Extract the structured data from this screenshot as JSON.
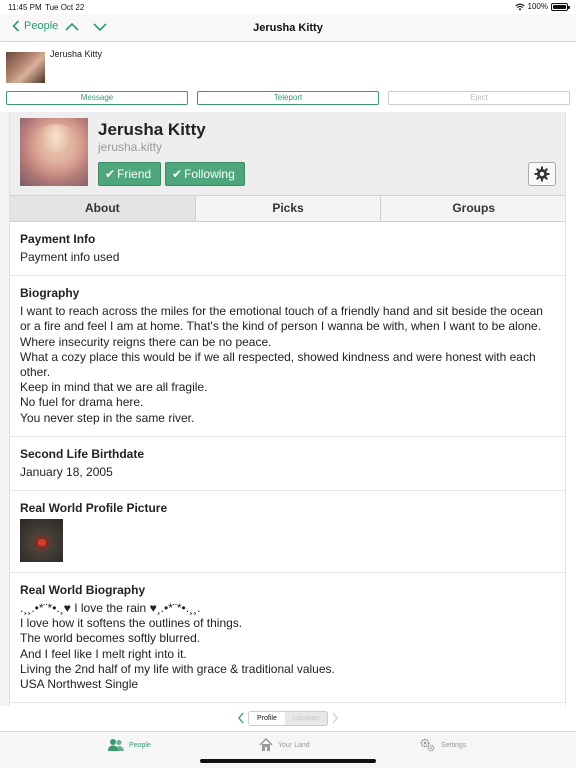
{
  "status_bar": {
    "time": "11:45 PM",
    "date": "Tue Oct 22",
    "battery": "100%"
  },
  "nav": {
    "back_label": "People",
    "title": "Jerusha Kitty"
  },
  "chat_header": {
    "name": "Jerusha Kitty"
  },
  "actions": {
    "message": "Message",
    "teleport": "Teleport",
    "eject": "Eject"
  },
  "profile": {
    "display_name": "Jerusha Kitty",
    "username": "jerusha.kitty",
    "friend_label": "Friend",
    "following_label": "Following"
  },
  "tabs": [
    {
      "label": "About",
      "active": true
    },
    {
      "label": "Picks",
      "active": false
    },
    {
      "label": "Groups",
      "active": false
    }
  ],
  "sections": {
    "payment": {
      "title": "Payment Info",
      "value": "Payment info used"
    },
    "biography": {
      "title": "Biography",
      "lines": [
        "I want to reach across the miles for the emotional touch of a friendly hand and sit beside the ocean or a fire and feel I am at home. That's the kind of person I wanna be with, when I want to be alone.",
        "Where insecurity reigns there can be no peace.",
        "What a cozy place this would be if we all respected, showed kindness and were honest with each other.",
        "Keep in mind that we are all fragile.",
        "No fuel for drama here.",
        "You never step in the same river."
      ]
    },
    "birthdate": {
      "title": "Second Life Birthdate",
      "value": "January 18, 2005"
    },
    "rw_picture": {
      "title": "Real World Profile Picture"
    },
    "rw_biography": {
      "title": "Real World Biography",
      "lines": [
        ".¸¸.•*¨*•.¸♥ I love the rain ♥¸.•*¨*•.¸¸.",
        "I love how it softens the outlines of things.",
        "The world becomes softly blurred.",
        "And I feel like I melt right into it.",
        "Living the 2nd half of my life with grace & traditional values.",
        "USA Northwest Single"
      ]
    }
  },
  "segmented": {
    "profile": "Profile",
    "location": "Location"
  },
  "tabbar": {
    "people": "People",
    "your_land": "Your Land",
    "settings": "Settings"
  },
  "colors": {
    "accent": "#3a9a6e",
    "pill": "#4ea67c"
  }
}
